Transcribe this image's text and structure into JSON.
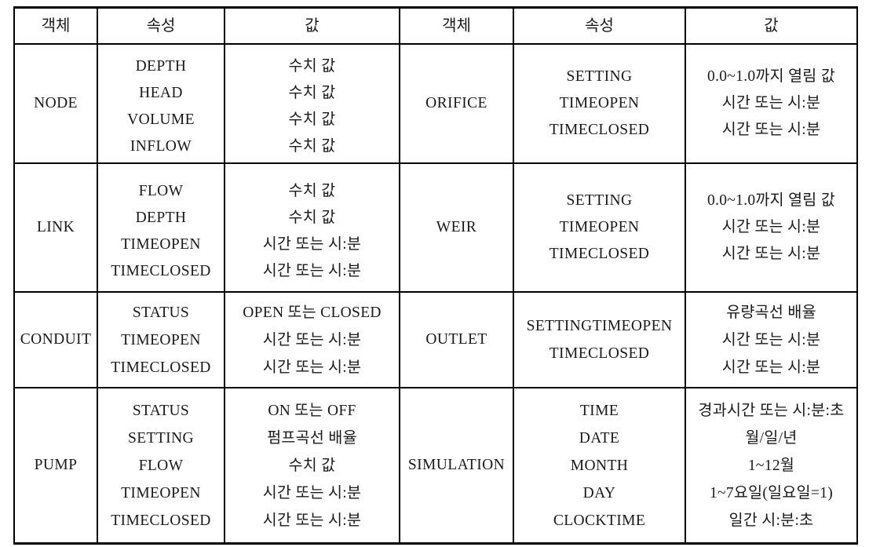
{
  "table": {
    "headers_left": [
      "객체",
      "속성",
      "값"
    ],
    "headers_right": [
      "객체",
      "속성",
      "값"
    ],
    "rows": [
      {
        "left": {
          "object": "NODE",
          "attributes": [
            "DEPTH",
            "HEAD",
            "VOLUME",
            "INFLOW"
          ],
          "values": [
            "수치 값",
            "수치 값",
            "수치 값",
            "수치 값"
          ]
        },
        "right": {
          "object": "ORIFICE",
          "attributes": [
            "SETTING",
            "TIMEOPEN",
            "TIMECLOSED"
          ],
          "values": [
            "0.0~1.0까지 열림 값",
            "시간 또는 시:분",
            "시간 또는 시:분"
          ]
        }
      },
      {
        "left": {
          "object": "LINK",
          "attributes": [
            "FLOW",
            "DEPTH",
            "TIMEOPEN",
            "TIMECLOSED"
          ],
          "values": [
            "수치 값",
            "수치 값",
            "시간 또는 시:분",
            "시간 또는 시:분"
          ]
        },
        "right": {
          "object": "WEIR",
          "attributes": [
            "SETTING",
            "TIMEOPEN",
            "TIMECLOSED"
          ],
          "values": [
            "0.0~1.0까지 열림 값",
            "시간 또는 시:분",
            "시간 또는 시:분"
          ]
        }
      },
      {
        "left": {
          "object": "CONDUIT",
          "attributes": [
            "STATUS",
            "TIMEOPEN",
            "TIMECLOSED"
          ],
          "values": [
            "OPEN 또는 CLOSED",
            "시간 또는 시:분",
            "시간 또는 시:분"
          ]
        },
        "right": {
          "object": "OUTLET",
          "attributes": [
            "SETTINGTIMEOPEN",
            "TIMECLOSED"
          ],
          "values": [
            "유량곡선 배율",
            "시간 또는 시:분",
            "시간 또는 시:분"
          ]
        }
      },
      {
        "left": {
          "object": "PUMP",
          "attributes": [
            "STATUS",
            "SETTING",
            "FLOW",
            "TIMEOPEN",
            "TIMECLOSED"
          ],
          "values": [
            "ON 또는 OFF",
            "펌프곡선 배율",
            "수치 값",
            "시간 또는 시:분",
            "시간 또는 시:분"
          ]
        },
        "right": {
          "object": "SIMULATION",
          "attributes": [
            "TIME",
            "DATE",
            "MONTH",
            "DAY",
            "CLOCKTIME"
          ],
          "values": [
            "경과시간 또는 시:분:초",
            "월/일/년",
            "1~12월",
            "1~7요일(일요일=1)",
            "일간 시:분:초"
          ]
        }
      }
    ]
  },
  "colors": {
    "border": "#000000",
    "text": "#1a1a1a",
    "background": "#ffffff"
  }
}
